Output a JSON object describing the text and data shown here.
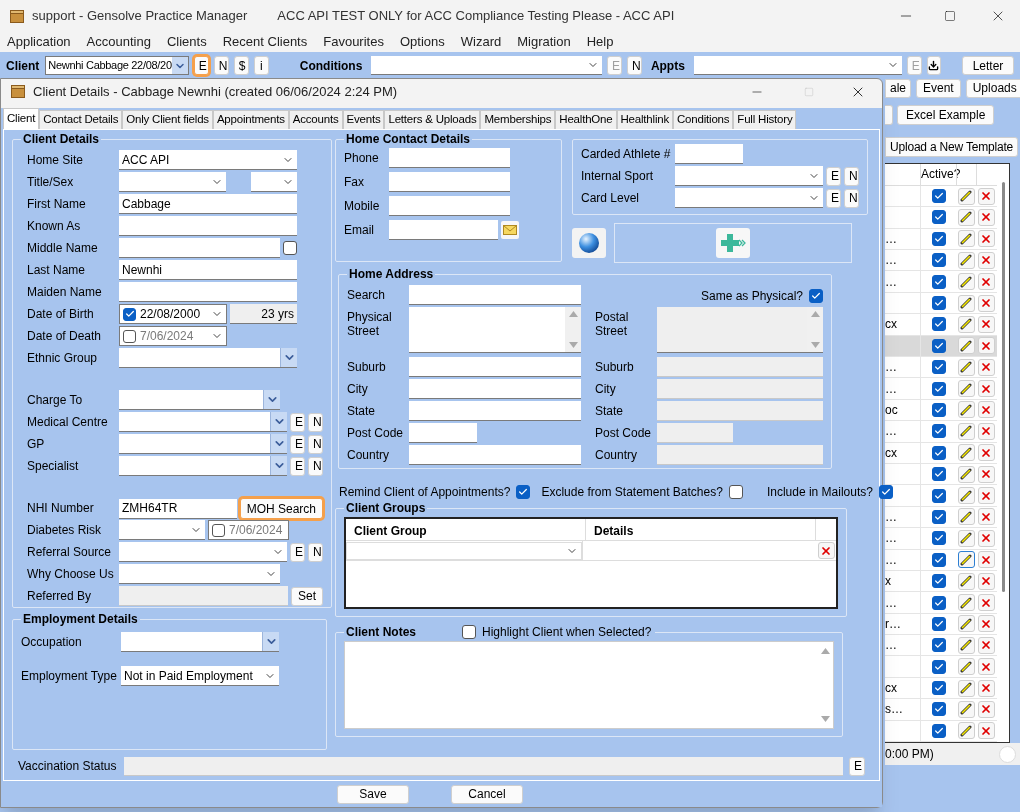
{
  "app": {
    "title": "support - Gensolve Practice Manager",
    "subtitle": "ACC API TEST ONLY for ACC Compliance Testing Please - ACC API"
  },
  "menu": [
    "Application",
    "Accounting",
    "Clients",
    "Recent Clients",
    "Favourites",
    "Options",
    "Wizard",
    "Migration",
    "Help"
  ],
  "toolbar": {
    "client_label": "Client",
    "client_value": "Newnhi Cabbage 22/08/20",
    "client_buttons": [
      {
        "label": "E",
        "highlighted": true
      },
      {
        "label": "N",
        "highlighted": false
      },
      {
        "label": "$",
        "highlighted": false
      },
      {
        "label": "i",
        "highlighted": false
      }
    ],
    "conditions_label": "Conditions",
    "conditions_buttons": [
      {
        "label": "E",
        "disabled": true
      },
      {
        "label": "N",
        "disabled": false
      }
    ],
    "appts_label": "Appts",
    "appts_buttons": [
      {
        "label": "E",
        "disabled": true
      }
    ],
    "letter": "Letter"
  },
  "side_buttons": [
    "ale",
    "Event",
    "Uploads"
  ],
  "excel_button": "Excel Example",
  "upload_button": "Upload a New Template",
  "templates": {
    "active_column": "Active?",
    "rows": [
      {
        "text": "",
        "active": true,
        "selected": false,
        "edit_focused": false
      },
      {
        "text": "",
        "active": true,
        "selected": false,
        "edit_focused": false
      },
      {
        "text": "…",
        "active": true,
        "selected": false,
        "edit_focused": false
      },
      {
        "text": "…",
        "active": true,
        "selected": false,
        "edit_focused": false
      },
      {
        "text": "…",
        "active": true,
        "selected": false,
        "edit_focused": false
      },
      {
        "text": "",
        "active": true,
        "selected": false,
        "edit_focused": false
      },
      {
        "text": "cx",
        "active": true,
        "selected": false,
        "edit_focused": false
      },
      {
        "text": "",
        "active": true,
        "selected": true,
        "edit_focused": false
      },
      {
        "text": "…",
        "active": true,
        "selected": false,
        "edit_focused": false
      },
      {
        "text": "…",
        "active": true,
        "selected": false,
        "edit_focused": false
      },
      {
        "text": "oc",
        "active": true,
        "selected": false,
        "edit_focused": false
      },
      {
        "text": "…",
        "active": true,
        "selected": false,
        "edit_focused": false
      },
      {
        "text": "cx",
        "active": true,
        "selected": false,
        "edit_focused": false
      },
      {
        "text": "",
        "active": true,
        "selected": false,
        "edit_focused": false
      },
      {
        "text": "",
        "active": true,
        "selected": false,
        "edit_focused": false
      },
      {
        "text": "…",
        "active": true,
        "selected": false,
        "edit_focused": false
      },
      {
        "text": "…",
        "active": true,
        "selected": false,
        "edit_focused": false
      },
      {
        "text": "…",
        "active": true,
        "selected": false,
        "edit_focused": true
      },
      {
        "text": "x",
        "active": true,
        "selected": false,
        "edit_focused": false
      },
      {
        "text": "…",
        "active": true,
        "selected": false,
        "edit_focused": false
      },
      {
        "text": "r…",
        "active": true,
        "selected": false,
        "edit_focused": false
      },
      {
        "text": "…",
        "active": true,
        "selected": false,
        "edit_focused": false
      },
      {
        "text": "",
        "active": true,
        "selected": false,
        "edit_focused": false
      },
      {
        "text": "cx",
        "active": true,
        "selected": false,
        "edit_focused": false
      },
      {
        "text": "s…",
        "active": true,
        "selected": false,
        "edit_focused": false
      },
      {
        "text": "",
        "active": true,
        "selected": false,
        "edit_focused": false
      }
    ]
  },
  "status_text": "0:00 PM)",
  "dialog": {
    "title": "Client Details - Cabbage Newnhi (created 06/06/2024 2:24 PM)",
    "tabs": [
      {
        "label": "Client",
        "selected": true
      },
      {
        "label": "Contact Details",
        "selected": false
      },
      {
        "label": "Only Client fields",
        "selected": false
      },
      {
        "label": "Appointments",
        "selected": false
      },
      {
        "label": "Accounts",
        "selected": false
      },
      {
        "label": "Events",
        "selected": false
      },
      {
        "label": "Letters & Uploads",
        "selected": false
      },
      {
        "label": "Memberships",
        "selected": false
      },
      {
        "label": "HealthOne",
        "selected": false
      },
      {
        "label": "Healthlink",
        "selected": false
      },
      {
        "label": "Conditions",
        "selected": false
      },
      {
        "label": "Full History",
        "selected": false
      }
    ],
    "client_details": {
      "title": "Client Details",
      "sections": [
        [
          {
            "label": "Home Site",
            "controls": [
              {
                "kind": "combo",
                "value": "ACC API"
              }
            ]
          },
          {
            "label": "Title/Sex",
            "controls": [
              {
                "kind": "combo"
              },
              {
                "kind": "small_combo"
              }
            ]
          },
          {
            "label": "First Name",
            "controls": [
              {
                "kind": "text",
                "value": "Cabbage"
              }
            ]
          },
          {
            "label": "Known As",
            "controls": [
              {
                "kind": "text"
              }
            ]
          },
          {
            "label": "Middle Name",
            "controls": [
              {
                "kind": "text"
              },
              {
                "kind": "check",
                "checked": false
              }
            ]
          },
          {
            "label": "Last Name",
            "controls": [
              {
                "kind": "text",
                "value": "Newnhi"
              }
            ]
          },
          {
            "label": "Maiden Name",
            "controls": [
              {
                "kind": "text"
              }
            ]
          },
          {
            "label": "Date of Birth",
            "controls": [
              {
                "kind": "date",
                "checked": true,
                "value": "22/08/2000"
              },
              {
                "kind": "age",
                "value": "23 yrs"
              }
            ]
          },
          {
            "label": "Date of Death",
            "controls": [
              {
                "kind": "date",
                "checked": false,
                "value": "7/06/2024"
              }
            ]
          },
          {
            "label": "Ethnic Group",
            "controls": [
              {
                "kind": "lookup"
              }
            ]
          }
        ],
        [
          {
            "label": "Charge To",
            "controls": [
              {
                "kind": "lookup"
              },
              {
                "kind": "spacer"
              }
            ]
          },
          {
            "label": "Medical Centre",
            "controls": [
              {
                "kind": "lookup"
              },
              {
                "kind": "button",
                "label": "E",
                "highlighted": false
              },
              {
                "kind": "button",
                "label": "N",
                "highlighted": false
              }
            ]
          },
          {
            "label": "GP",
            "controls": [
              {
                "kind": "lookup"
              },
              {
                "kind": "button",
                "label": "E",
                "highlighted": false
              },
              {
                "kind": "button",
                "label": "N",
                "highlighted": false
              }
            ]
          },
          {
            "label": "Specialist",
            "controls": [
              {
                "kind": "lookup"
              },
              {
                "kind": "button",
                "label": "E",
                "highlighted": false
              },
              {
                "kind": "button",
                "label": "N",
                "highlighted": false
              }
            ]
          }
        ],
        [
          {
            "label": "NHI Number",
            "controls": [
              {
                "kind": "text",
                "value": "ZMH64TR"
              },
              {
                "kind": "button",
                "label": "MOH Search",
                "highlighted": true
              }
            ]
          },
          {
            "label": "Diabetes Risk",
            "controls": [
              {
                "kind": "short_combo"
              },
              {
                "kind": "calendar_date",
                "checked": false,
                "value": "7/06/2024"
              }
            ]
          },
          {
            "label": "Referral Source",
            "controls": [
              {
                "kind": "combo"
              },
              {
                "kind": "button",
                "label": "E",
                "highlighted": false
              },
              {
                "kind": "button",
                "label": "N",
                "highlighted": false
              }
            ]
          },
          {
            "label": "Why Choose Us",
            "controls": [
              {
                "kind": "combo"
              },
              {
                "kind": "spacer"
              }
            ]
          },
          {
            "label": "Referred By",
            "controls": [
              {
                "kind": "readonly"
              },
              {
                "kind": "button",
                "label": "Set",
                "highlighted": false
              }
            ]
          }
        ]
      ]
    },
    "employment": {
      "title": "Employment Details",
      "rows": [
        {
          "label": "Occupation",
          "controls": [
            {
              "kind": "lookup"
            }
          ]
        },
        {
          "label": "Employment Type",
          "controls": [
            {
              "kind": "combo",
              "value": "Not in Paid Employment"
            }
          ]
        }
      ]
    },
    "home_contact": {
      "title": "Home Contact Details",
      "rows": [
        {
          "label": "Phone",
          "controls": [
            {
              "kind": "text"
            },
            {
              "kind": "spacer"
            }
          ]
        },
        {
          "label": "Fax",
          "controls": [
            {
              "kind": "text"
            },
            {
              "kind": "spacer"
            }
          ]
        },
        {
          "label": "Mobile",
          "controls": [
            {
              "kind": "text"
            },
            {
              "kind": "spacer"
            }
          ]
        },
        {
          "label": "Email",
          "controls": [
            {
              "kind": "text"
            },
            {
              "kind": "mail"
            }
          ]
        }
      ]
    },
    "sport": {
      "rows": [
        {
          "label": "Carded Athlete #",
          "controls": [
            {
              "kind": "short_text"
            }
          ]
        },
        {
          "label": "Internal Sport",
          "controls": [
            {
              "kind": "combo"
            },
            {
              "kind": "button",
              "label": "E",
              "highlighted": false
            },
            {
              "kind": "button",
              "label": "N",
              "highlighted": false
            }
          ]
        },
        {
          "label": "Card Level",
          "controls": [
            {
              "kind": "combo"
            },
            {
              "kind": "button",
              "label": "E",
              "highlighted": false
            },
            {
              "kind": "button",
              "label": "N",
              "highlighted": false
            }
          ]
        }
      ]
    },
    "home_address": {
      "title": "Home Address",
      "same_as_physical": {
        "label": "Same as Physical?",
        "checked": true
      },
      "physical": [
        {
          "label": "Search",
          "controls": [
            {
              "kind": "text"
            }
          ]
        },
        {
          "label": "Physical Street",
          "controls": [
            {
              "kind": "textarea"
            }
          ]
        },
        {
          "label": "Suburb",
          "controls": [
            {
              "kind": "text"
            }
          ]
        },
        {
          "label": "City",
          "controls": [
            {
              "kind": "text"
            }
          ]
        },
        {
          "label": "State",
          "controls": [
            {
              "kind": "text"
            }
          ]
        },
        {
          "label": "Post Code",
          "controls": [
            {
              "kind": "short_text"
            }
          ]
        },
        {
          "label": "Country",
          "controls": [
            {
              "kind": "text"
            }
          ]
        }
      ],
      "postal": [
        {
          "label": "Postal Street",
          "controls": [
            {
              "kind": "readonly_textarea"
            }
          ]
        },
        {
          "label": "Suburb",
          "controls": [
            {
              "kind": "readonly"
            }
          ]
        },
        {
          "label": "City",
          "controls": [
            {
              "kind": "readonly"
            }
          ]
        },
        {
          "label": "State",
          "controls": [
            {
              "kind": "readonly"
            }
          ]
        },
        {
          "label": "Post Code",
          "controls": [
            {
              "kind": "readonly_short"
            }
          ]
        },
        {
          "label": "Country",
          "controls": [
            {
              "kind": "readonly"
            }
          ]
        }
      ]
    },
    "options": [
      {
        "label": "Remind Client of Appointments?",
        "checked": true
      },
      {
        "label": "Exclude from Statement Batches?",
        "checked": false
      },
      {
        "label": "Include in Mailouts?",
        "checked": true
      }
    ],
    "client_groups": {
      "title": "Client Groups",
      "columns": [
        "Client Group",
        "Details"
      ],
      "rows": [
        {
          "kind": "combo_row"
        }
      ]
    },
    "client_notes": {
      "title": "Client Notes",
      "highlight": {
        "label": "Highlight Client when Selected?",
        "checked": false
      }
    },
    "vaccination": {
      "label": "Vaccination Status",
      "button": "E"
    },
    "buttons": [
      "Save",
      "Cancel"
    ]
  }
}
